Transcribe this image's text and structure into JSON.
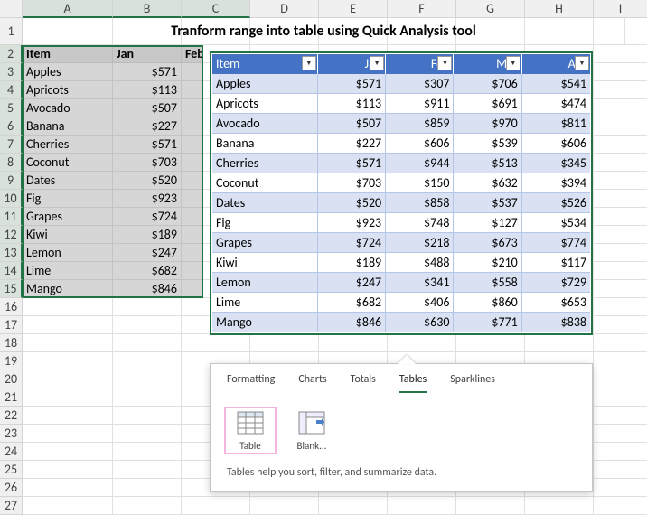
{
  "title": "Tranform range into table using Quick Analysis tool",
  "columns": [
    "A",
    "B",
    "C",
    "D",
    "E",
    "F",
    "G",
    "H",
    "I"
  ],
  "rowcount": 27,
  "sel_headers": {
    "item": "Item",
    "jan": "Jan",
    "feb": "Feb"
  },
  "sel_rows": [
    {
      "item": "Apples",
      "jan": "$571"
    },
    {
      "item": "Apricots",
      "jan": "$113"
    },
    {
      "item": "Avocado",
      "jan": "$507"
    },
    {
      "item": "Banana",
      "jan": "$227"
    },
    {
      "item": "Cherries",
      "jan": "$571"
    },
    {
      "item": "Coconut",
      "jan": "$703"
    },
    {
      "item": "Dates",
      "jan": "$520"
    },
    {
      "item": "Fig",
      "jan": "$923"
    },
    {
      "item": "Grapes",
      "jan": "$724"
    },
    {
      "item": "Kiwi",
      "jan": "$189"
    },
    {
      "item": "Lemon",
      "jan": "$247"
    },
    {
      "item": "Lime",
      "jan": "$682"
    },
    {
      "item": "Mango",
      "jan": "$846"
    }
  ],
  "table_headers": [
    "Item",
    "Jan",
    "Feb",
    "Mar",
    "Apr"
  ],
  "table_rows": [
    {
      "item": "Apples",
      "jan": "$571",
      "feb": "$307",
      "mar": "$706",
      "apr": "$541"
    },
    {
      "item": "Apricots",
      "jan": "$113",
      "feb": "$911",
      "mar": "$691",
      "apr": "$474"
    },
    {
      "item": "Avocado",
      "jan": "$507",
      "feb": "$859",
      "mar": "$970",
      "apr": "$811"
    },
    {
      "item": "Banana",
      "jan": "$227",
      "feb": "$606",
      "mar": "$539",
      "apr": "$606"
    },
    {
      "item": "Cherries",
      "jan": "$571",
      "feb": "$944",
      "mar": "$513",
      "apr": "$345"
    },
    {
      "item": "Coconut",
      "jan": "$703",
      "feb": "$150",
      "mar": "$632",
      "apr": "$394"
    },
    {
      "item": "Dates",
      "jan": "$520",
      "feb": "$858",
      "mar": "$537",
      "apr": "$526"
    },
    {
      "item": "Fig",
      "jan": "$923",
      "feb": "$748",
      "mar": "$127",
      "apr": "$534"
    },
    {
      "item": "Grapes",
      "jan": "$724",
      "feb": "$218",
      "mar": "$673",
      "apr": "$774"
    },
    {
      "item": "Kiwi",
      "jan": "$189",
      "feb": "$488",
      "mar": "$210",
      "apr": "$117"
    },
    {
      "item": "Lemon",
      "jan": "$247",
      "feb": "$341",
      "mar": "$558",
      "apr": "$729"
    },
    {
      "item": "Lime",
      "jan": "$682",
      "feb": "$406",
      "mar": "$860",
      "apr": "$653"
    },
    {
      "item": "Mango",
      "jan": "$846",
      "feb": "$630",
      "mar": "$771",
      "apr": "$838"
    }
  ],
  "qa": {
    "tabs": [
      "Formatting",
      "Charts",
      "Totals",
      "Tables",
      "Sparklines"
    ],
    "active": 3,
    "options": [
      {
        "label": "Table",
        "icon": "table"
      },
      {
        "label": "Blank...",
        "icon": "blank"
      }
    ],
    "hint": "Tables help you sort, filter, and summarize data."
  }
}
